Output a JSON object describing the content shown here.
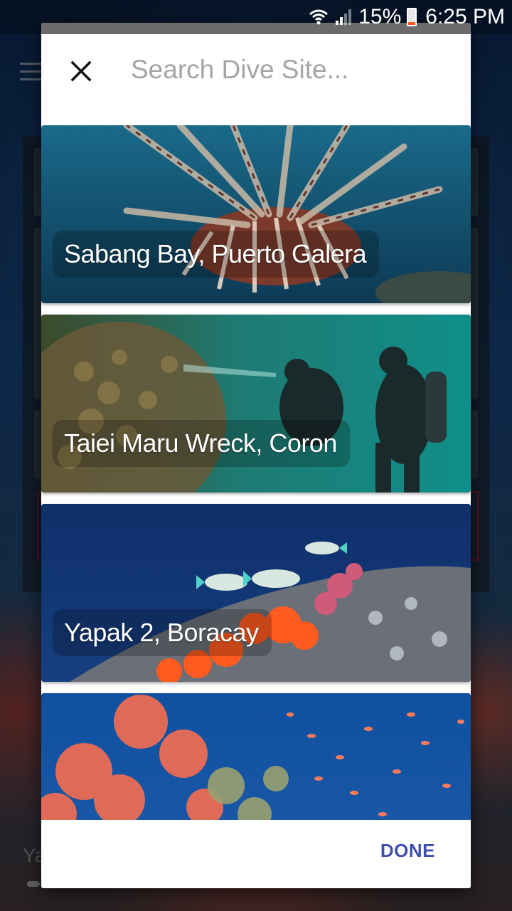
{
  "status_bar": {
    "battery_percent": "15%",
    "time": "6:25 PM",
    "icons": [
      "wifi-icon",
      "signal-icon",
      "battery-icon"
    ]
  },
  "background": {
    "menu_icon": "hamburger-icon",
    "partial_text": "Ya"
  },
  "dialog": {
    "close_icon": "close-icon",
    "search": {
      "placeholder": "Search Dive Site...",
      "value": ""
    },
    "sites": [
      {
        "label": "Sabang Bay, Puerto Galera",
        "image": "lionfish-photo"
      },
      {
        "label": "Taiei Maru Wreck, Coron",
        "image": "wreck-divers-photo"
      },
      {
        "label": "Yapak 2, Boracay",
        "image": "reef-fish-photo"
      },
      {
        "label": "",
        "image": "coral-reef-photo"
      }
    ],
    "done_label": "DONE"
  },
  "colors": {
    "accent": "#3f4fb0",
    "placeholder": "#a5a5a5",
    "battery_low": "#ff5a1f"
  }
}
